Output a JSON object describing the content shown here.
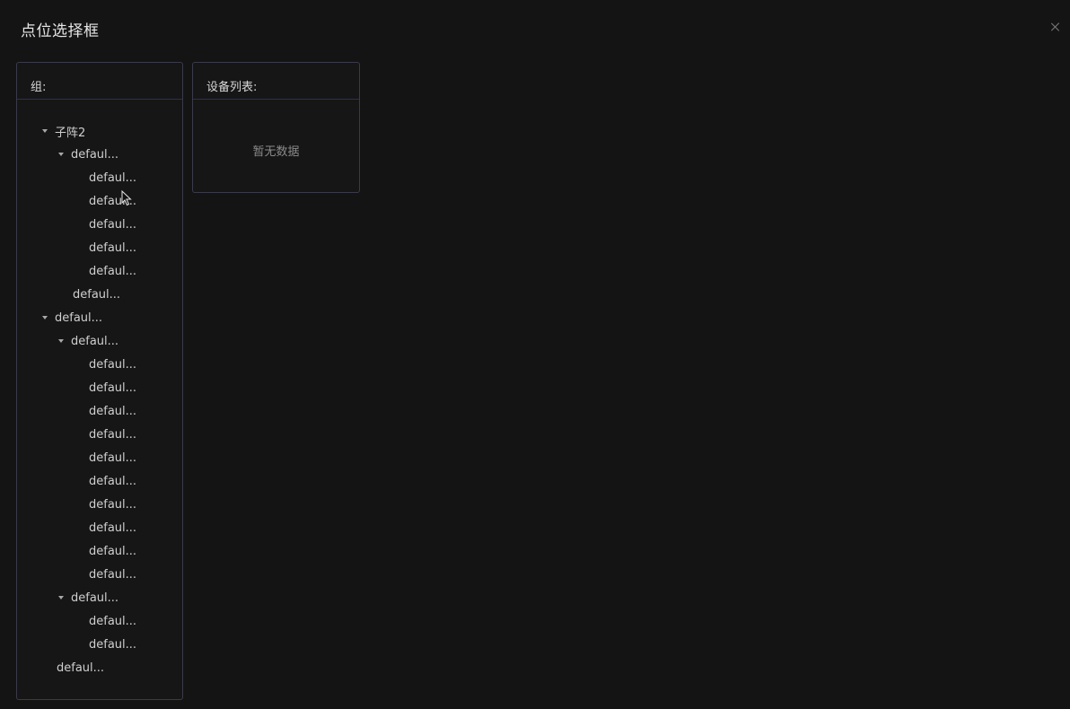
{
  "dialog": {
    "title": "点位选择框"
  },
  "group_panel": {
    "header": "组:",
    "nodes": [
      {
        "label": "子阵2",
        "level": 0,
        "expanded": true
      },
      {
        "label": "defaul...",
        "level": 1,
        "expanded": true
      },
      {
        "label": "defaul...",
        "level": 2
      },
      {
        "label": "defaul...",
        "level": 2
      },
      {
        "label": "defaul...",
        "level": 2
      },
      {
        "label": "defaul...",
        "level": 2
      },
      {
        "label": "defaul...",
        "level": 2
      },
      {
        "label": "defaul...",
        "level": 1
      },
      {
        "label": "defaul...",
        "level": 0,
        "expanded": true
      },
      {
        "label": "defaul...",
        "level": 1,
        "expanded": true
      },
      {
        "label": "defaul...",
        "level": 2
      },
      {
        "label": "defaul...",
        "level": 2
      },
      {
        "label": "defaul...",
        "level": 2
      },
      {
        "label": "defaul...",
        "level": 2
      },
      {
        "label": "defaul...",
        "level": 2
      },
      {
        "label": "defaul...",
        "level": 2
      },
      {
        "label": "defaul...",
        "level": 2
      },
      {
        "label": "defaul...",
        "level": 2
      },
      {
        "label": "defaul...",
        "level": 2
      },
      {
        "label": "defaul...",
        "level": 2
      },
      {
        "label": "defaul...",
        "level": 1,
        "expanded": true
      },
      {
        "label": "defaul...",
        "level": 2
      },
      {
        "label": "defaul...",
        "level": 2
      },
      {
        "label": "defaul...",
        "level": 0
      }
    ]
  },
  "device_panel": {
    "header": "设备列表:",
    "empty_text": "暂无数据"
  },
  "colors": {
    "background": "#141414",
    "panel_border": "#3a3a4a",
    "header_divider": "#2f2f5a",
    "text": "#cfcfcf",
    "muted_text": "#8a8a8a"
  },
  "icons": {
    "close": "close-icon",
    "caret": "caret-down-icon",
    "pointer": "mouse-cursor-icon"
  }
}
